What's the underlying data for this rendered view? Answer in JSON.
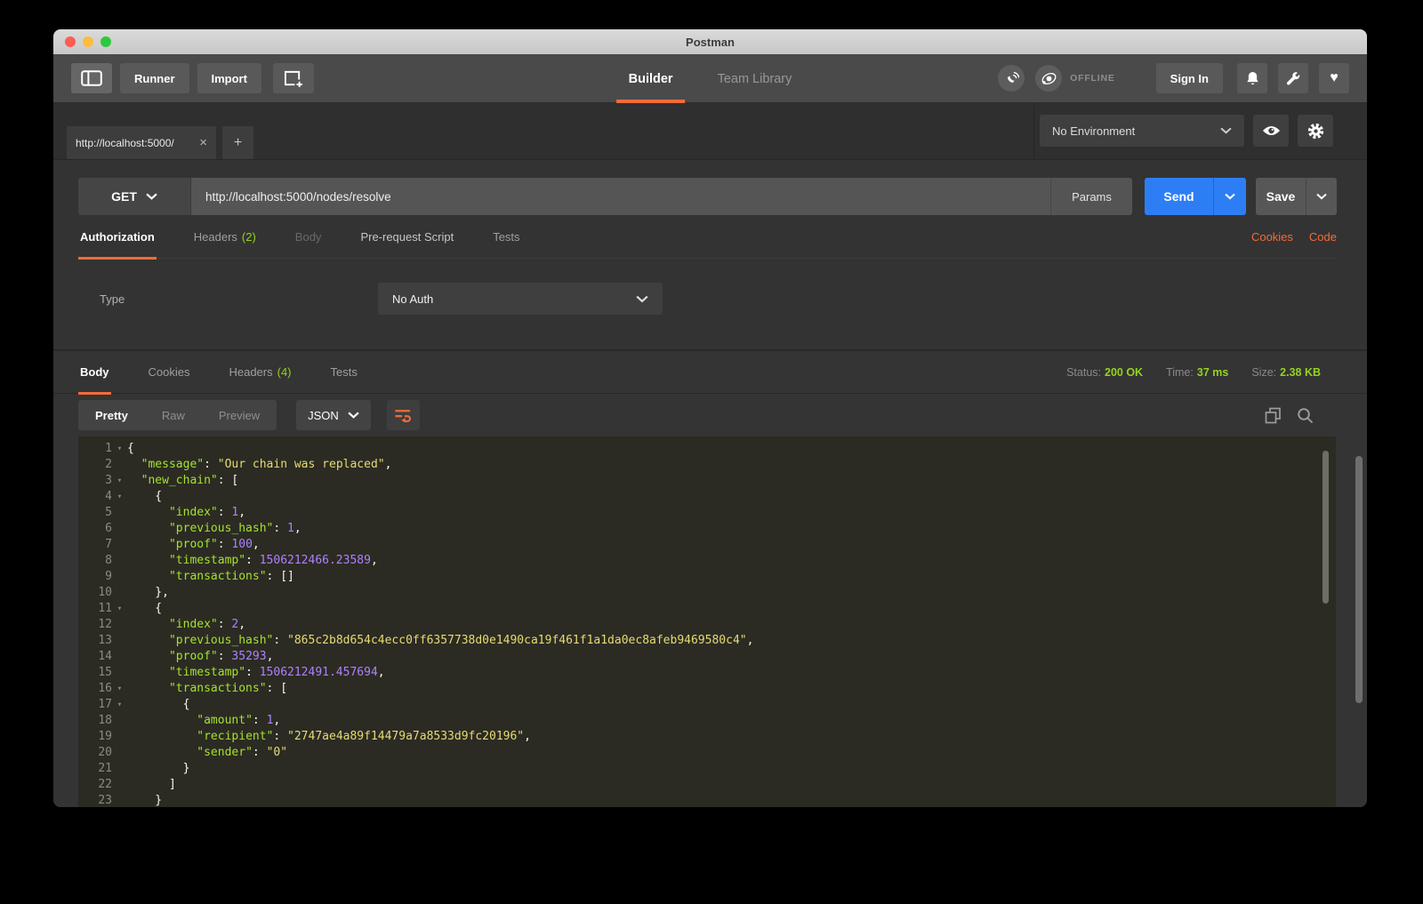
{
  "window": {
    "title": "Postman"
  },
  "toolbar": {
    "runner": "Runner",
    "import": "Import",
    "tabs": [
      {
        "label": "Builder",
        "active": true
      },
      {
        "label": "Team Library",
        "active": false
      }
    ],
    "offline": "OFFLINE",
    "sign_in": "Sign In"
  },
  "env_bar": {
    "environment": "No Environment"
  },
  "request_tab": {
    "title": "http://localhost:5000/",
    "close": "×",
    "new_tab": "+"
  },
  "request": {
    "method": "GET",
    "url": "http://localhost:5000/nodes/resolve",
    "params": "Params",
    "send": "Send",
    "save": "Save",
    "tabs": [
      {
        "label": "Authorization"
      },
      {
        "label": "Headers",
        "count": "(2)"
      },
      {
        "label": "Body"
      },
      {
        "label": "Pre-request Script"
      },
      {
        "label": "Tests"
      }
    ],
    "links": {
      "cookies": "Cookies",
      "code": "Code"
    },
    "auth": {
      "type_label": "Type",
      "type_value": "No Auth"
    }
  },
  "response": {
    "tabs": [
      {
        "label": "Body"
      },
      {
        "label": "Cookies"
      },
      {
        "label": "Headers",
        "count": "(4)"
      },
      {
        "label": "Tests"
      }
    ],
    "status": [
      {
        "label": "Status:",
        "value": "200 OK"
      },
      {
        "label": "Time:",
        "value": "37 ms"
      },
      {
        "label": "Size:",
        "value": "2.38 KB"
      }
    ],
    "view_modes": [
      {
        "label": "Pretty",
        "active": true
      },
      {
        "label": "Raw",
        "active": false
      },
      {
        "label": "Preview",
        "active": false
      }
    ],
    "format": "JSON",
    "body_lines": [
      {
        "n": 1,
        "fold": true,
        "tokens": [
          {
            "c": "p",
            "s": "{"
          }
        ]
      },
      {
        "n": 2,
        "fold": false,
        "tokens": [
          {
            "c": "p",
            "s": "  "
          },
          {
            "c": "k",
            "s": "\"message\""
          },
          {
            "c": "p",
            "s": ": "
          },
          {
            "c": "s",
            "s": "\"Our chain was replaced\""
          },
          {
            "c": "p",
            "s": ","
          }
        ]
      },
      {
        "n": 3,
        "fold": true,
        "tokens": [
          {
            "c": "p",
            "s": "  "
          },
          {
            "c": "k",
            "s": "\"new_chain\""
          },
          {
            "c": "p",
            "s": ": ["
          }
        ]
      },
      {
        "n": 4,
        "fold": true,
        "tokens": [
          {
            "c": "p",
            "s": "    {"
          }
        ]
      },
      {
        "n": 5,
        "fold": false,
        "tokens": [
          {
            "c": "p",
            "s": "      "
          },
          {
            "c": "k",
            "s": "\"index\""
          },
          {
            "c": "p",
            "s": ": "
          },
          {
            "c": "m",
            "s": "1"
          },
          {
            "c": "p",
            "s": ","
          }
        ]
      },
      {
        "n": 6,
        "fold": false,
        "tokens": [
          {
            "c": "p",
            "s": "      "
          },
          {
            "c": "k",
            "s": "\"previous_hash\""
          },
          {
            "c": "p",
            "s": ": "
          },
          {
            "c": "m",
            "s": "1"
          },
          {
            "c": "p",
            "s": ","
          }
        ]
      },
      {
        "n": 7,
        "fold": false,
        "tokens": [
          {
            "c": "p",
            "s": "      "
          },
          {
            "c": "k",
            "s": "\"proof\""
          },
          {
            "c": "p",
            "s": ": "
          },
          {
            "c": "m",
            "s": "100"
          },
          {
            "c": "p",
            "s": ","
          }
        ]
      },
      {
        "n": 8,
        "fold": false,
        "tokens": [
          {
            "c": "p",
            "s": "      "
          },
          {
            "c": "k",
            "s": "\"timestamp\""
          },
          {
            "c": "p",
            "s": ": "
          },
          {
            "c": "m",
            "s": "1506212466.23589"
          },
          {
            "c": "p",
            "s": ","
          }
        ]
      },
      {
        "n": 9,
        "fold": false,
        "tokens": [
          {
            "c": "p",
            "s": "      "
          },
          {
            "c": "k",
            "s": "\"transactions\""
          },
          {
            "c": "p",
            "s": ": []"
          }
        ]
      },
      {
        "n": 10,
        "fold": false,
        "tokens": [
          {
            "c": "p",
            "s": "    },"
          }
        ]
      },
      {
        "n": 11,
        "fold": true,
        "tokens": [
          {
            "c": "p",
            "s": "    {"
          }
        ]
      },
      {
        "n": 12,
        "fold": false,
        "tokens": [
          {
            "c": "p",
            "s": "      "
          },
          {
            "c": "k",
            "s": "\"index\""
          },
          {
            "c": "p",
            "s": ": "
          },
          {
            "c": "m",
            "s": "2"
          },
          {
            "c": "p",
            "s": ","
          }
        ]
      },
      {
        "n": 13,
        "fold": false,
        "tokens": [
          {
            "c": "p",
            "s": "      "
          },
          {
            "c": "k",
            "s": "\"previous_hash\""
          },
          {
            "c": "p",
            "s": ": "
          },
          {
            "c": "s",
            "s": "\"865c2b8d654c4ecc0ff6357738d0e1490ca19f461f1a1da0ec8afeb9469580c4\""
          },
          {
            "c": "p",
            "s": ","
          }
        ]
      },
      {
        "n": 14,
        "fold": false,
        "tokens": [
          {
            "c": "p",
            "s": "      "
          },
          {
            "c": "k",
            "s": "\"proof\""
          },
          {
            "c": "p",
            "s": ": "
          },
          {
            "c": "m",
            "s": "35293"
          },
          {
            "c": "p",
            "s": ","
          }
        ]
      },
      {
        "n": 15,
        "fold": false,
        "tokens": [
          {
            "c": "p",
            "s": "      "
          },
          {
            "c": "k",
            "s": "\"timestamp\""
          },
          {
            "c": "p",
            "s": ": "
          },
          {
            "c": "m",
            "s": "1506212491.457694"
          },
          {
            "c": "p",
            "s": ","
          }
        ]
      },
      {
        "n": 16,
        "fold": true,
        "tokens": [
          {
            "c": "p",
            "s": "      "
          },
          {
            "c": "k",
            "s": "\"transactions\""
          },
          {
            "c": "p",
            "s": ": ["
          }
        ]
      },
      {
        "n": 17,
        "fold": true,
        "tokens": [
          {
            "c": "p",
            "s": "        {"
          }
        ]
      },
      {
        "n": 18,
        "fold": false,
        "tokens": [
          {
            "c": "p",
            "s": "          "
          },
          {
            "c": "k",
            "s": "\"amount\""
          },
          {
            "c": "p",
            "s": ": "
          },
          {
            "c": "m",
            "s": "1"
          },
          {
            "c": "p",
            "s": ","
          }
        ]
      },
      {
        "n": 19,
        "fold": false,
        "tokens": [
          {
            "c": "p",
            "s": "          "
          },
          {
            "c": "k",
            "s": "\"recipient\""
          },
          {
            "c": "p",
            "s": ": "
          },
          {
            "c": "s",
            "s": "\"2747ae4a89f14479a7a8533d9fc20196\""
          },
          {
            "c": "p",
            "s": ","
          }
        ]
      },
      {
        "n": 20,
        "fold": false,
        "tokens": [
          {
            "c": "p",
            "s": "          "
          },
          {
            "c": "k",
            "s": "\"sender\""
          },
          {
            "c": "p",
            "s": ": "
          },
          {
            "c": "s",
            "s": "\"0\""
          }
        ]
      },
      {
        "n": 21,
        "fold": false,
        "tokens": [
          {
            "c": "p",
            "s": "        }"
          }
        ]
      },
      {
        "n": 22,
        "fold": false,
        "tokens": [
          {
            "c": "p",
            "s": "      ]"
          }
        ]
      },
      {
        "n": 23,
        "fold": false,
        "tokens": [
          {
            "c": "p",
            "s": "    }"
          }
        ]
      }
    ]
  },
  "colors": {
    "accent_orange": "#f26b3a",
    "send_blue": "#2d7ef5",
    "status_green": "#94d31f",
    "code_key": "#a6e22e",
    "code_string": "#e6db74",
    "code_number": "#ae81ff",
    "code_plain": "#f8f8f2",
    "code_bg": "#2b2b23"
  }
}
